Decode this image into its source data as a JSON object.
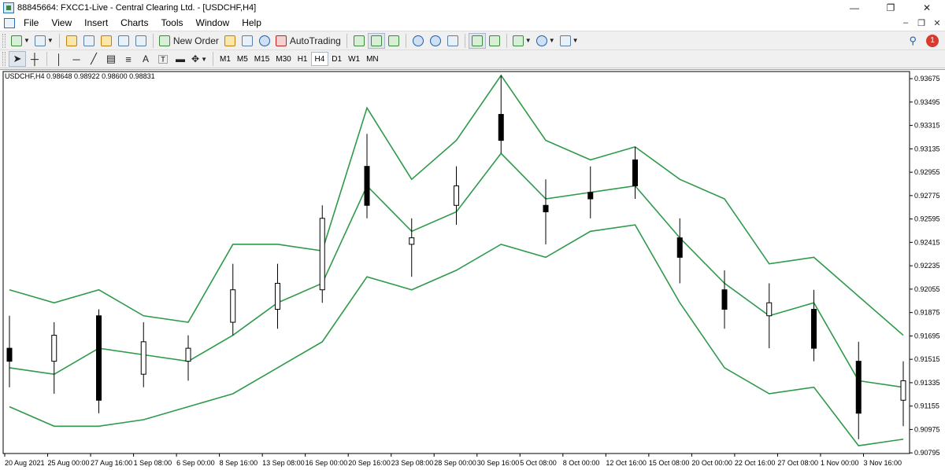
{
  "window": {
    "title": "88845664: FXCC1-Live - Central Clearing Ltd. - [USDCHF,H4]",
    "controls": [
      "—",
      "❐",
      "✕"
    ]
  },
  "menu": {
    "items": [
      "File",
      "View",
      "Insert",
      "Charts",
      "Tools",
      "Window",
      "Help"
    ],
    "right_controls": [
      "–",
      "❐",
      "✕"
    ]
  },
  "toolbar": {
    "new_order": "New Order",
    "auto_trading": "AutoTrading",
    "notification_count": "1"
  },
  "timeframes": [
    "M1",
    "M5",
    "M15",
    "M30",
    "H1",
    "H4",
    "D1",
    "W1",
    "MN"
  ],
  "active_timeframe": "H4",
  "chart": {
    "symbol_info": "USDCHF,H4  0.98648 0.98922 0.98600 0.98831",
    "price_labels": [
      "0.93675",
      "0.93495",
      "0.93315",
      "0.93135",
      "0.92955",
      "0.92775",
      "0.92595",
      "0.92415",
      "0.92235",
      "0.92055",
      "0.91875",
      "0.91695",
      "0.91515",
      "0.91335",
      "0.91155",
      "0.90975",
      "0.90795"
    ],
    "date_labels": [
      "20 Aug 2021",
      "25 Aug 00:00",
      "27 Aug 16:00",
      "1 Sep 08:00",
      "6 Sep 00:00",
      "8 Sep 16:00",
      "13 Sep 08:00",
      "16 Sep 00:00",
      "20 Sep 16:00",
      "23 Sep 08:00",
      "28 Sep 00:00",
      "30 Sep 16:00",
      "5 Oct 08:00",
      "8 Oct 00:00",
      "12 Oct 16:00",
      "15 Oct 08:00",
      "20 Oct 00:00",
      "22 Oct 16:00",
      "27 Oct 08:00",
      "1 Nov 00:00",
      "3 Nov 16:00"
    ],
    "colors": {
      "candle": "#000000",
      "bands": "#2e9a4a",
      "background": "#ffffff"
    }
  },
  "chart_data": {
    "type": "candlestick",
    "symbol": "USDCHF",
    "timeframe": "H4",
    "ylim": [
      0.9079,
      0.9373
    ],
    "indicator": "Bollinger Bands",
    "series": [
      {
        "name": "upper",
        "x": [
          "20 Aug 2021",
          "25 Aug 00:00",
          "27 Aug 16:00",
          "1 Sep 08:00",
          "6 Sep 00:00",
          "8 Sep 16:00",
          "13 Sep 08:00",
          "16 Sep 00:00",
          "20 Sep 16:00",
          "23 Sep 08:00",
          "28 Sep 00:00",
          "30 Sep 16:00",
          "5 Oct 08:00",
          "8 Oct 00:00",
          "12 Oct 16:00",
          "15 Oct 08:00",
          "20 Oct 00:00",
          "22 Oct 16:00",
          "27 Oct 08:00",
          "1 Nov 00:00",
          "3 Nov 16:00"
        ],
        "values": [
          0.9205,
          0.9195,
          0.9205,
          0.9185,
          0.918,
          0.924,
          0.924,
          0.9235,
          0.9345,
          0.929,
          0.932,
          0.937,
          0.932,
          0.9305,
          0.9315,
          0.929,
          0.9275,
          0.9225,
          0.923,
          0.92,
          0.917
        ]
      },
      {
        "name": "middle",
        "x": [
          "20 Aug 2021",
          "25 Aug 00:00",
          "27 Aug 16:00",
          "1 Sep 08:00",
          "6 Sep 00:00",
          "8 Sep 16:00",
          "13 Sep 08:00",
          "16 Sep 00:00",
          "20 Sep 16:00",
          "23 Sep 08:00",
          "28 Sep 00:00",
          "30 Sep 16:00",
          "5 Oct 08:00",
          "8 Oct 00:00",
          "12 Oct 16:00",
          "15 Oct 08:00",
          "20 Oct 00:00",
          "22 Oct 16:00",
          "27 Oct 08:00",
          "1 Nov 00:00",
          "3 Nov 16:00"
        ],
        "values": [
          0.9145,
          0.914,
          0.916,
          0.9155,
          0.915,
          0.917,
          0.9195,
          0.921,
          0.9285,
          0.925,
          0.9265,
          0.931,
          0.9275,
          0.928,
          0.9285,
          0.9245,
          0.921,
          0.9185,
          0.9195,
          0.9135,
          0.913
        ]
      },
      {
        "name": "lower",
        "x": [
          "20 Aug 2021",
          "25 Aug 00:00",
          "27 Aug 16:00",
          "1 Sep 08:00",
          "6 Sep 00:00",
          "8 Sep 16:00",
          "13 Sep 08:00",
          "16 Sep 00:00",
          "20 Sep 16:00",
          "23 Sep 08:00",
          "28 Sep 00:00",
          "30 Sep 16:00",
          "5 Oct 08:00",
          "8 Oct 00:00",
          "12 Oct 16:00",
          "15 Oct 08:00",
          "20 Oct 00:00",
          "22 Oct 16:00",
          "27 Oct 08:00",
          "1 Nov 00:00",
          "3 Nov 16:00"
        ],
        "values": [
          0.9115,
          0.91,
          0.91,
          0.9105,
          0.9115,
          0.9125,
          0.9145,
          0.9165,
          0.9215,
          0.9205,
          0.922,
          0.924,
          0.923,
          0.925,
          0.9255,
          0.9195,
          0.9145,
          0.9125,
          0.913,
          0.9085,
          0.909
        ]
      }
    ],
    "candles": [
      {
        "x": "20 Aug 2021",
        "o": 0.916,
        "h": 0.9185,
        "l": 0.913,
        "c": 0.915
      },
      {
        "x": "25 Aug 00:00",
        "o": 0.915,
        "h": 0.918,
        "l": 0.9125,
        "c": 0.917
      },
      {
        "x": "27 Aug 16:00",
        "o": 0.9185,
        "h": 0.919,
        "l": 0.911,
        "c": 0.912
      },
      {
        "x": "1 Sep 08:00",
        "o": 0.914,
        "h": 0.918,
        "l": 0.913,
        "c": 0.9165
      },
      {
        "x": "6 Sep 00:00",
        "o": 0.915,
        "h": 0.917,
        "l": 0.9135,
        "c": 0.916
      },
      {
        "x": "8 Sep 16:00",
        "o": 0.918,
        "h": 0.9225,
        "l": 0.917,
        "c": 0.9205
      },
      {
        "x": "13 Sep 08:00",
        "o": 0.919,
        "h": 0.9225,
        "l": 0.9175,
        "c": 0.921
      },
      {
        "x": "16 Sep 00:00",
        "o": 0.9205,
        "h": 0.927,
        "l": 0.9195,
        "c": 0.926
      },
      {
        "x": "20 Sep 16:00",
        "o": 0.93,
        "h": 0.9325,
        "l": 0.926,
        "c": 0.927
      },
      {
        "x": "23 Sep 08:00",
        "o": 0.924,
        "h": 0.926,
        "l": 0.9215,
        "c": 0.9245
      },
      {
        "x": "28 Sep 00:00",
        "o": 0.927,
        "h": 0.93,
        "l": 0.9255,
        "c": 0.9285
      },
      {
        "x": "30 Sep 16:00",
        "o": 0.934,
        "h": 0.937,
        "l": 0.931,
        "c": 0.932
      },
      {
        "x": "5 Oct 08:00",
        "o": 0.927,
        "h": 0.929,
        "l": 0.924,
        "c": 0.9265
      },
      {
        "x": "8 Oct 00:00",
        "o": 0.928,
        "h": 0.93,
        "l": 0.926,
        "c": 0.9275
      },
      {
        "x": "12 Oct 16:00",
        "o": 0.9305,
        "h": 0.9315,
        "l": 0.9275,
        "c": 0.9285
      },
      {
        "x": "15 Oct 08:00",
        "o": 0.9245,
        "h": 0.926,
        "l": 0.921,
        "c": 0.923
      },
      {
        "x": "20 Oct 00:00",
        "o": 0.9205,
        "h": 0.922,
        "l": 0.9175,
        "c": 0.919
      },
      {
        "x": "22 Oct 16:00",
        "o": 0.9185,
        "h": 0.921,
        "l": 0.916,
        "c": 0.9195
      },
      {
        "x": "27 Oct 08:00",
        "o": 0.919,
        "h": 0.9205,
        "l": 0.915,
        "c": 0.916
      },
      {
        "x": "1 Nov 00:00",
        "o": 0.915,
        "h": 0.9165,
        "l": 0.909,
        "c": 0.911
      },
      {
        "x": "3 Nov 16:00",
        "o": 0.912,
        "h": 0.915,
        "l": 0.91,
        "c": 0.9135
      }
    ]
  }
}
